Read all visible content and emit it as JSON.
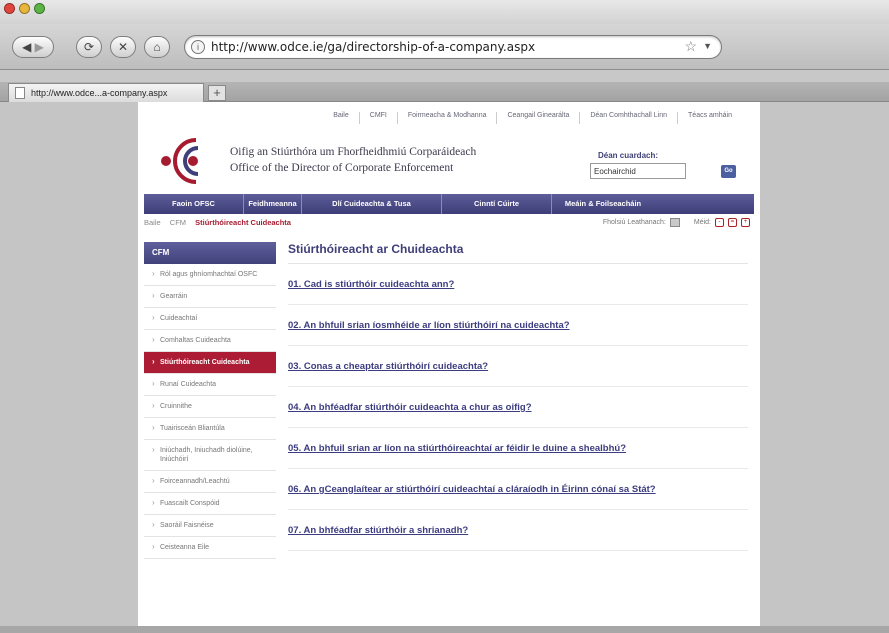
{
  "browser": {
    "url": "http://www.odce.ie/ga/directorship-of-a-company.aspx",
    "tab_title": "http://www.odce...a-company.aspx",
    "new_tab_label": "+"
  },
  "utility_nav": [
    "Baile",
    "CMFI",
    "Foirmeacha & Modhanna",
    "Ceangail Ginearálta",
    "Déan Comhthachall Linn",
    "Téacs amháin"
  ],
  "logo": {
    "line1": "Oifig an Stiúrthóra um Fhorfheidhmiú Corparáideach",
    "line2": "Office of the Director of Corporate Enforcement"
  },
  "search": {
    "label": "Déan cuardach:",
    "value": "Eochairchid",
    "go_label": "Go"
  },
  "main_nav": [
    "Faoin OFSC",
    "Feidhmeanna",
    "Dlí Cuideachta & Tusa",
    "Cinntí Cúirte",
    "Meáin & Foilseacháin"
  ],
  "breadcrumb": [
    "Baile",
    "CFM",
    "Stiúrthóireacht Cuideachta"
  ],
  "page_tools": {
    "print_label": "Fholsiú Leathanach:",
    "size_label": "Méid:"
  },
  "sidebar": {
    "heading": "CFM",
    "items": [
      "Ról agus ghníomhachtaí OSFC",
      "Gearráin",
      "Cuideachtaí",
      "Comhaltas Cuideachta",
      "Stiúrthóireacht Cuideachta",
      "Runaí Cuideachta",
      "Cruinnithe",
      "Tuairisceán Bliantúla",
      "Iniúchadh, Iniuchadh diolúine, Iniúchóirí",
      "Foirceannadh/Leachtú",
      "Fuascailt Conspóid",
      "Saoráil Faisnéise",
      "Ceisteanna Eile"
    ],
    "active_index": 4
  },
  "content": {
    "title": "Stiúrthóireacht ar Chuideachta",
    "questions": [
      "01. Cad is stiúrthóir cuideachta ann?",
      "02. An bhfuil srian íosmhéide ar líon stiúrthóirí na cuideachta?",
      "03. Conas a cheaptar stiúrthóirí cuideachta?",
      "04. An bhféadfar stiúrthóir cuideachta a chur as oifig?",
      "05. An bhfuil srian ar líon na stiúrthóireachtaí ar féidir le duine a shealbhú?",
      "06. An gCeanglaítear ar stiúrthóirí cuideachtaí a cláraíodh in Éirinn cónaí sa Stát?",
      "07. An bhféadfar stiúrthóir a shrianadh?"
    ]
  },
  "colors": {
    "nav_purple": "#41417a",
    "active_red": "#ac1d35",
    "link_blue": "#3c3c80"
  }
}
